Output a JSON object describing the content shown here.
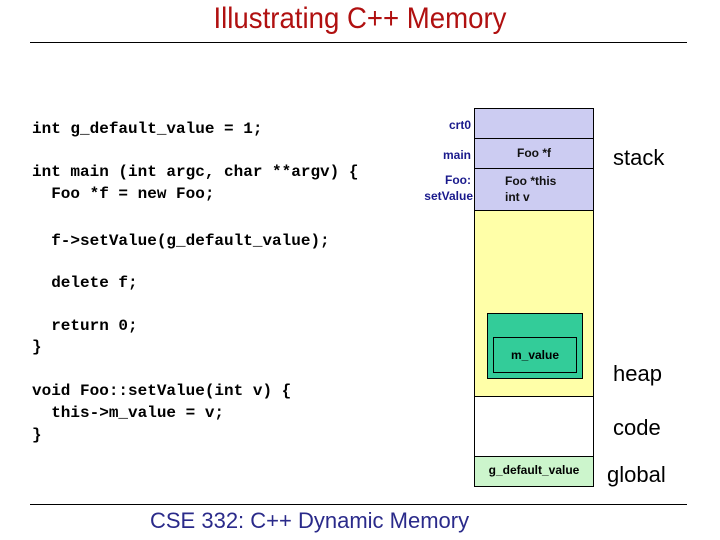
{
  "slide": {
    "title": "Illustrating C++ Memory",
    "footer": "CSE 332: C++ Dynamic Memory",
    "colors": {
      "title": "#b01010",
      "footer": "#2a2a8a",
      "stack": "#ccccf2",
      "heap": "#ffffa8",
      "object": "#33cc99",
      "global": "#ccf5cc"
    }
  },
  "code_lines": [
    "int g_default_value = 1;",
    "int main (int argc, char **argv) {",
    "  Foo *f = new Foo;",
    "  f->setValue(g_default_value);",
    "  delete f;",
    "  return 0;",
    "}",
    "void Foo::setValue(int v) {",
    "  this->m_value = v;",
    "}"
  ],
  "memory": {
    "stack_frames": [
      {
        "label": "crt0",
        "contents": ""
      },
      {
        "label": "main",
        "contents": "Foo *f"
      },
      {
        "label_line1": "Foo:",
        "label_line2": "setValue",
        "contents_line1": "Foo *this",
        "contents_line2": "int v"
      }
    ],
    "heap_object_field": "m_value",
    "global_variable": "g_default_value",
    "region_labels": {
      "stack": "stack",
      "heap": "heap",
      "code": "code",
      "global": "global"
    }
  }
}
